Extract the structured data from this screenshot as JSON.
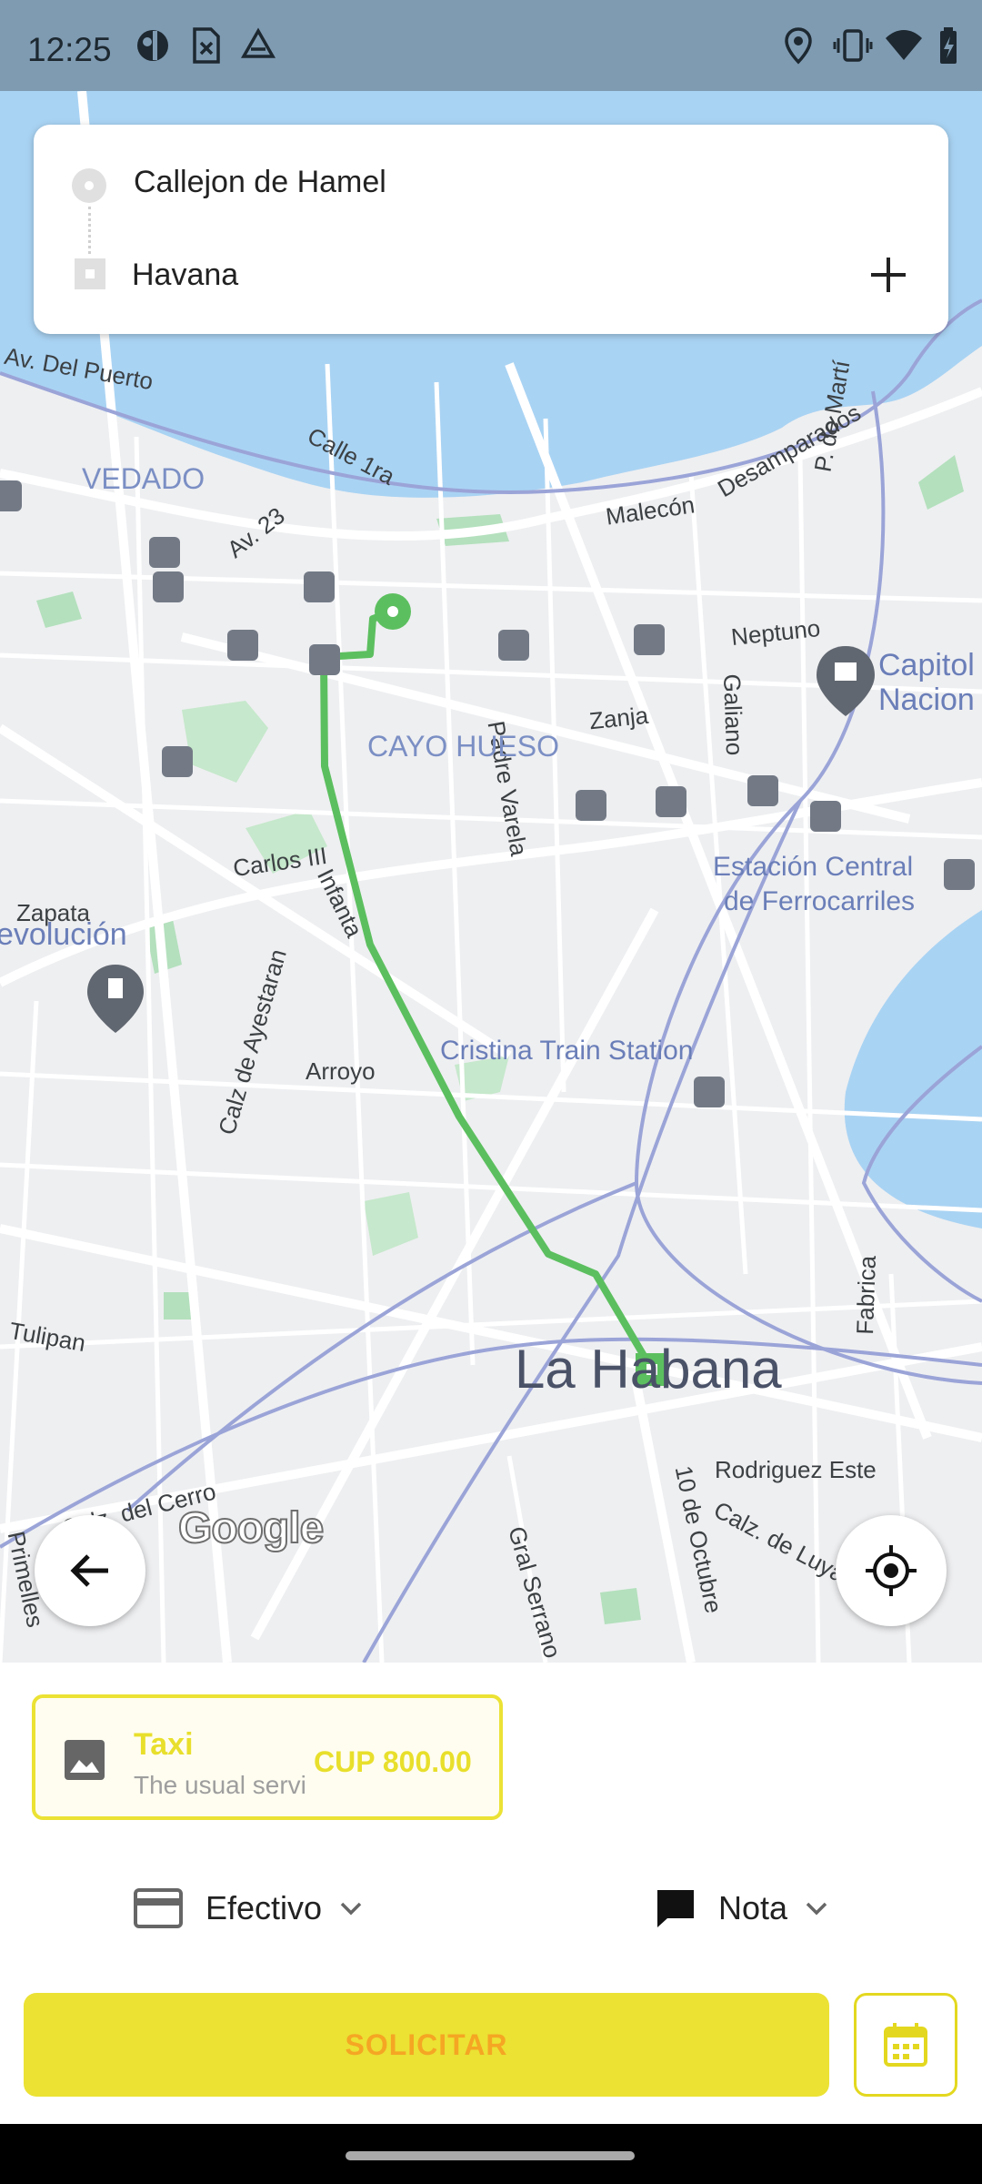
{
  "status_bar": {
    "time": "12:25",
    "left_icons": [
      "app-icon",
      "sim-icon",
      "drive-icon"
    ],
    "right_icons": [
      "location-icon",
      "vibrate-icon",
      "wifi-icon",
      "battery-icon"
    ]
  },
  "route": {
    "origin": "Callejon de Hamel",
    "destination": "Havana",
    "add_stop_icon": "plus-icon"
  },
  "map": {
    "labels": {
      "av_del_puerto": "Av. Del Puerto",
      "vedado": "VEDADO",
      "calle_1ra": "Calle 1ra",
      "av_23": "Av. 23",
      "malecon": "Malecón",
      "desamparados": "Desamparados",
      "p_de_marti": "P. de Martí",
      "padre_varela": "Padre Varela",
      "neptuno": "Neptuno",
      "galiano": "Galiano",
      "capitolio_1": "Capitol",
      "capitolio_2": "Nacion",
      "zanja": "Zanja",
      "cayo_hueso": "CAYO HUESO",
      "infanta": "Infanta",
      "carlos_iii": "Carlos III",
      "estacion_1": "Estación Central",
      "estacion_2": "de Ferrocarriles",
      "zapata": "Zapata",
      "revolucion": "evolución",
      "calz_ayestaran": "Calz de Ayestaran",
      "arroyo": "Arroyo",
      "cristina": "Cristina Train Station",
      "tulipan": "Tulipan",
      "fabrica": "Fabrica",
      "la_habana": "La Habana",
      "rodriguez": "Rodriguez Este",
      "diez_octubre": "10 de Octubre",
      "calz_luyano": "Calz. de Luyano",
      "gral_serrano": "Gral Serrano",
      "primelles": "Primelles",
      "calz_cerro": "Calz. del Cerro"
    },
    "attribution": "Google",
    "route_color": "#5cbf5f"
  },
  "service": {
    "name": "Taxi",
    "description": "The usual service",
    "price": "CUP 800.00",
    "accent": "#ebe234"
  },
  "payment": {
    "label": "Efectivo"
  },
  "note": {
    "label": "Nota"
  },
  "actions": {
    "request_label": "SOLICITAR"
  }
}
